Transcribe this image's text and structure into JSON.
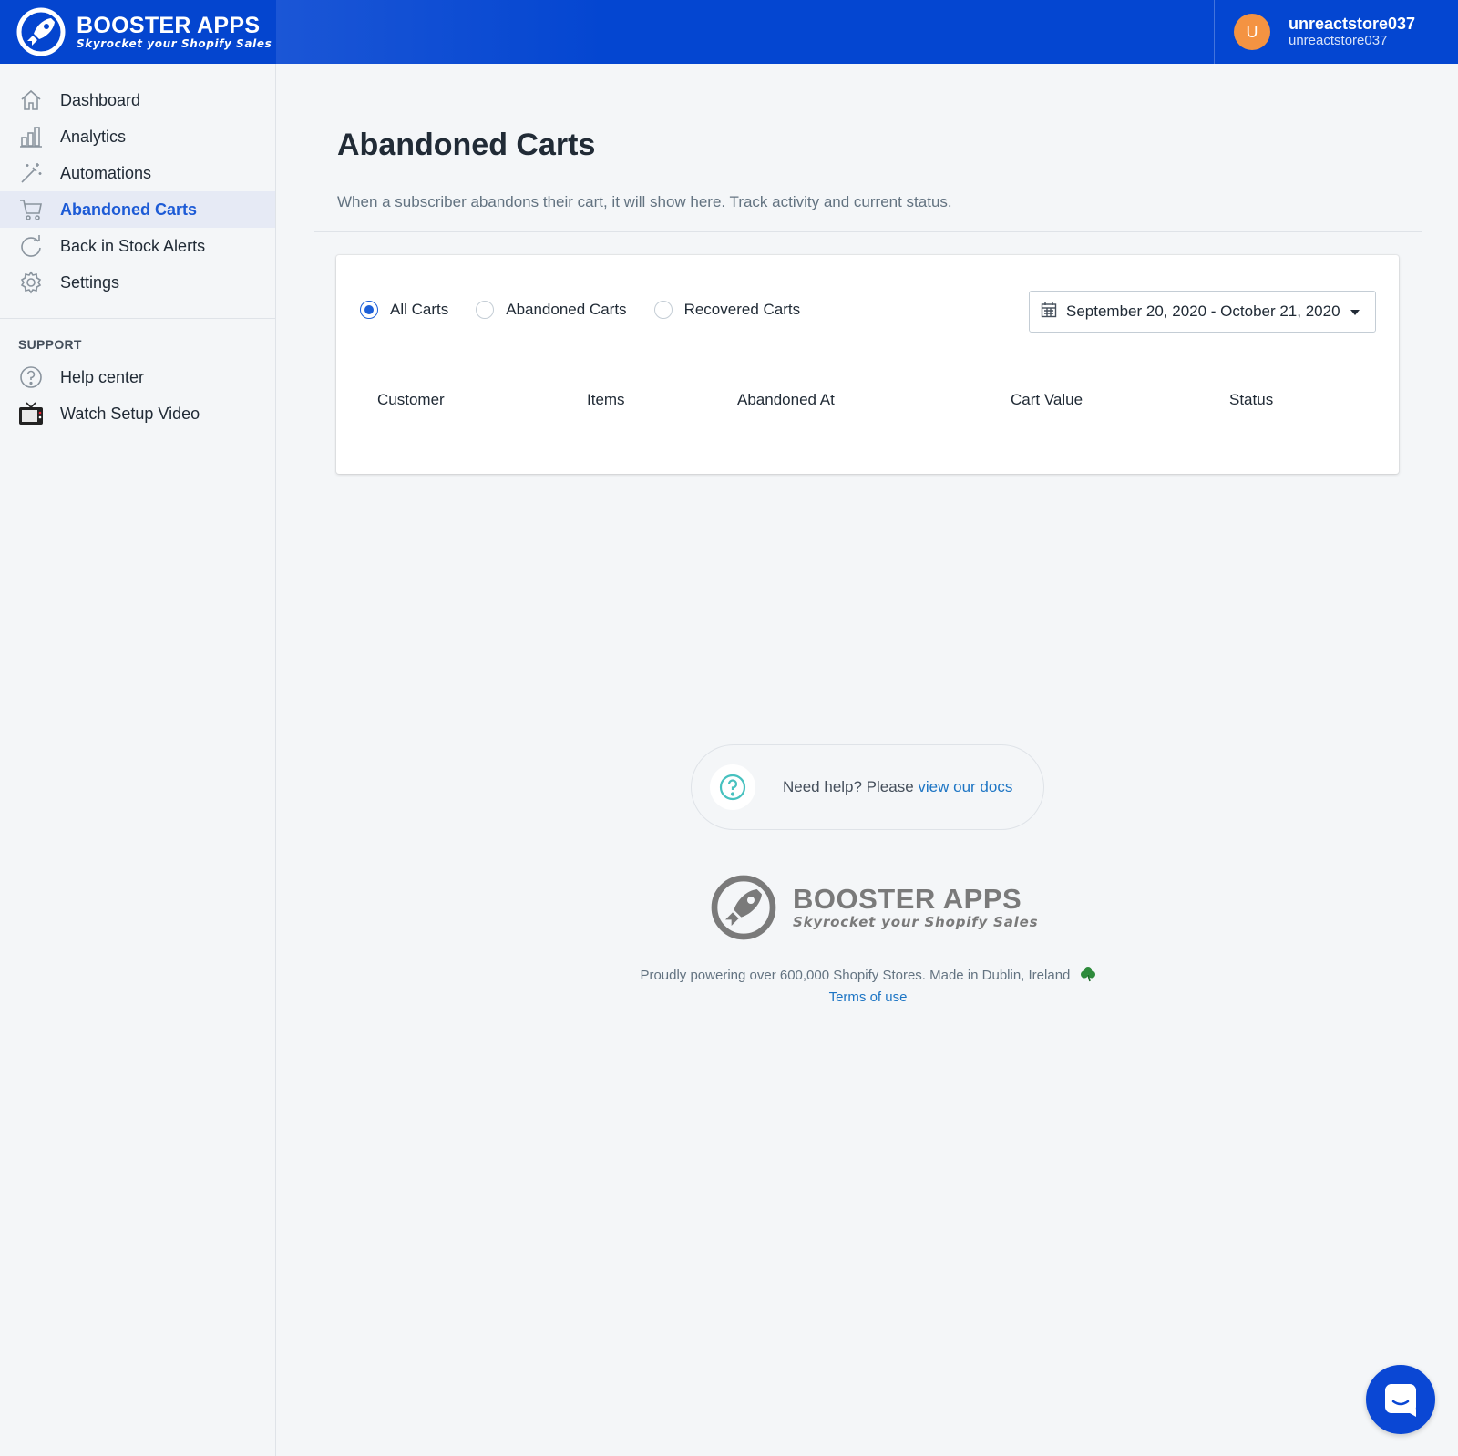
{
  "brand": {
    "name": "BOOSTER APPS",
    "tagline": "Skyrocket your Shopify Sales"
  },
  "user": {
    "initial": "U",
    "name": "unreactstore037",
    "store": "unreactstore037"
  },
  "sidebar": {
    "items": [
      {
        "label": "Dashboard",
        "icon": "home-icon"
      },
      {
        "label": "Analytics",
        "icon": "bar-chart-icon"
      },
      {
        "label": "Automations",
        "icon": "magic-wand-icon"
      },
      {
        "label": "Abandoned Carts",
        "icon": "cart-icon",
        "active": true
      },
      {
        "label": "Back in Stock Alerts",
        "icon": "refresh-icon"
      },
      {
        "label": "Settings",
        "icon": "gear-icon"
      }
    ],
    "support_heading": "SUPPORT",
    "support_items": [
      {
        "label": "Help center",
        "icon": "question-icon"
      },
      {
        "label": "Watch Setup Video",
        "icon": "tv-icon"
      }
    ]
  },
  "page": {
    "title": "Abandoned Carts",
    "subtitle": "When a subscriber abandons their cart, it will show here. Track activity and current status."
  },
  "filters": {
    "options": [
      "All Carts",
      "Abandoned Carts",
      "Recovered Carts"
    ],
    "selected": "All Carts",
    "date_range": "September 20, 2020 - October 21, 2020"
  },
  "table": {
    "columns": [
      "Customer",
      "Items",
      "Abandoned At",
      "Cart Value",
      "Status"
    ],
    "rows": []
  },
  "help": {
    "prefix": "Need help? Please ",
    "link": "view our docs"
  },
  "footer": {
    "brand_name": "BOOSTER APPS",
    "brand_tagline": "Skyrocket your Shopify Sales",
    "text": "Proudly powering over 600,000 Shopify Stores. Made in Dublin, Ireland",
    "terms": "Terms of use"
  },
  "colors": {
    "header": "#0446d1",
    "accent": "#1d5bd6",
    "avatar": "#f49342"
  }
}
